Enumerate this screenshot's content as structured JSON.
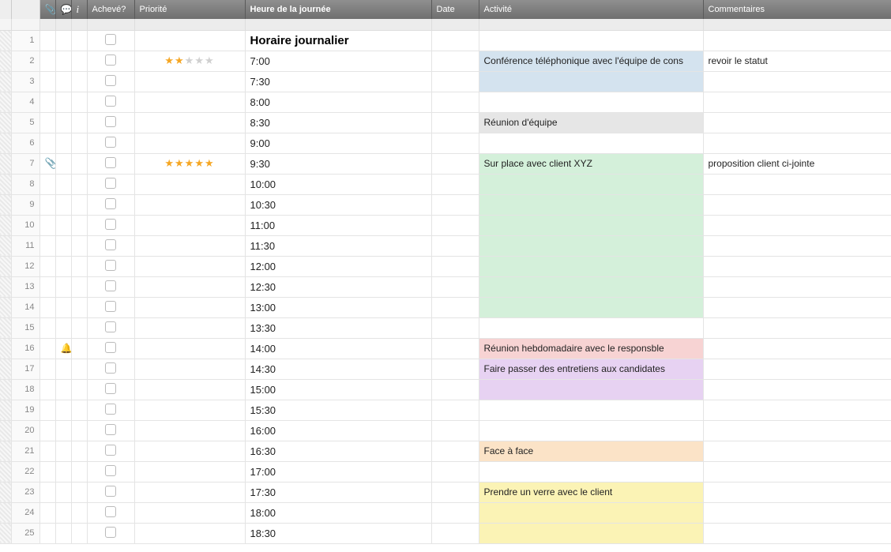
{
  "headers": {
    "attach_icon": "📎",
    "comment_icon": "💬",
    "info_icon": "i",
    "done": "Achevé?",
    "priority": "Priorité",
    "time": "Heure de la journée",
    "date": "Date",
    "activity": "Activité",
    "comments": "Commentaires"
  },
  "title_row_time": "Horaire journalier",
  "rows": [
    {
      "num": 1,
      "title": true,
      "time": "Horaire journalier"
    },
    {
      "num": 2,
      "time": "7:00",
      "stars": 2,
      "activity": "Conférence téléphonique avec l'équipe de cons",
      "activity_bg": "bg-blue",
      "comment": "revoir le statut"
    },
    {
      "num": 3,
      "time": "7:30",
      "activity_bg": "bg-blue"
    },
    {
      "num": 4,
      "time": "8:00"
    },
    {
      "num": 5,
      "time": "8:30",
      "activity": "Réunion d'équipe",
      "activity_bg": "bg-grey"
    },
    {
      "num": 6,
      "time": "9:00"
    },
    {
      "num": 7,
      "time": "9:30",
      "stars": 5,
      "attach": true,
      "activity": "Sur place avec client XYZ",
      "activity_bg": "bg-green",
      "comment": "proposition client ci-jointe"
    },
    {
      "num": 8,
      "time": "10:00",
      "activity_bg": "bg-green"
    },
    {
      "num": 9,
      "time": "10:30",
      "activity_bg": "bg-green"
    },
    {
      "num": 10,
      "time": "11:00",
      "activity_bg": "bg-green"
    },
    {
      "num": 11,
      "time": "11:30",
      "activity_bg": "bg-green"
    },
    {
      "num": 12,
      "time": "12:00",
      "activity_bg": "bg-green"
    },
    {
      "num": 13,
      "time": "12:30",
      "activity_bg": "bg-green"
    },
    {
      "num": 14,
      "time": "13:00",
      "activity_bg": "bg-green"
    },
    {
      "num": 15,
      "time": "13:30"
    },
    {
      "num": 16,
      "time": "14:00",
      "bell": true,
      "activity": "Réunion hebdomadaire avec le responsble",
      "activity_bg": "bg-pink"
    },
    {
      "num": 17,
      "time": "14:30",
      "activity": "Faire passer des entretiens aux candidates",
      "activity_bg": "bg-purple"
    },
    {
      "num": 18,
      "time": "15:00",
      "activity_bg": "bg-purple"
    },
    {
      "num": 19,
      "time": "15:30"
    },
    {
      "num": 20,
      "time": "16:00"
    },
    {
      "num": 21,
      "time": "16:30",
      "activity": "Face à face",
      "activity_bg": "bg-orange"
    },
    {
      "num": 22,
      "time": "17:00"
    },
    {
      "num": 23,
      "time": "17:30",
      "activity": "Prendre un verre avec le client",
      "activity_bg": "bg-yellow"
    },
    {
      "num": 24,
      "time": "18:00",
      "activity_bg": "bg-yellow"
    },
    {
      "num": 25,
      "time": "18:30",
      "activity_bg": "bg-yellow"
    }
  ]
}
